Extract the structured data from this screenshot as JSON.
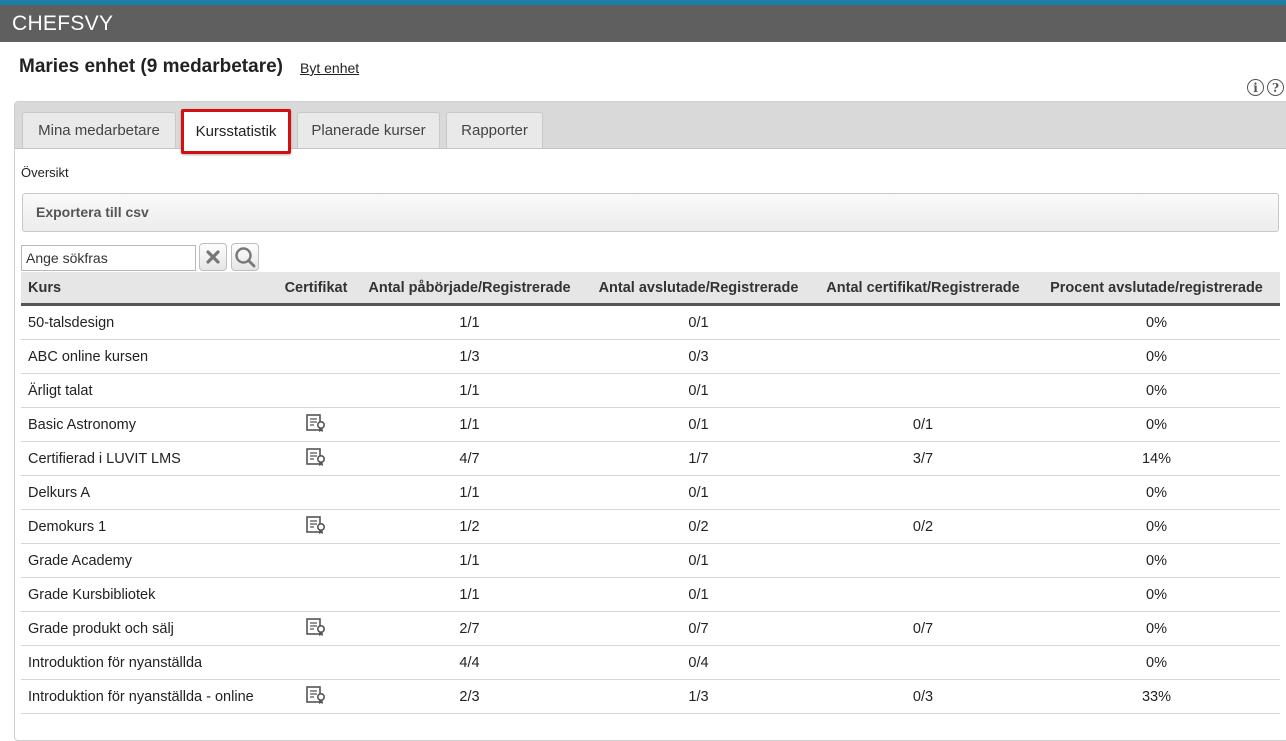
{
  "app": {
    "title": "CHEFSVY"
  },
  "unit": {
    "title": "Maries enhet (9 medarbetare)",
    "change_link": "Byt enhet"
  },
  "help": {
    "info_icon": "info-icon",
    "help_icon": "help-icon"
  },
  "tabs": [
    {
      "label": "Mina medarbetare",
      "active": false
    },
    {
      "label": "Kursstatistik",
      "active": true
    },
    {
      "label": "Planerade kurser",
      "active": false
    },
    {
      "label": "Rapporter",
      "active": false
    }
  ],
  "section": {
    "title": "Översikt",
    "export_label": "Exportera till csv"
  },
  "search": {
    "placeholder": "Ange sökfras",
    "clear_icon": "close-icon",
    "search_icon": "search-icon"
  },
  "table": {
    "columns": [
      "Kurs",
      "Certifikat",
      "Antal påbörjade/Registrerade",
      "Antal avslutade/Registrerade",
      "Antal certifikat/Registrerade",
      "Procent avslutade/registrerade"
    ],
    "rows": [
      {
        "course": "50-talsdesign",
        "certificate": false,
        "started": "1/1",
        "completed": "0/1",
        "certs": "",
        "percent": "0%"
      },
      {
        "course": "ABC online kursen",
        "certificate": false,
        "started": "1/3",
        "completed": "0/3",
        "certs": "",
        "percent": "0%"
      },
      {
        "course": "Ärligt talat",
        "certificate": false,
        "started": "1/1",
        "completed": "0/1",
        "certs": "",
        "percent": "0%"
      },
      {
        "course": "Basic Astronomy",
        "certificate": true,
        "started": "1/1",
        "completed": "0/1",
        "certs": "0/1",
        "percent": "0%"
      },
      {
        "course": "Certifierad i LUVIT LMS",
        "certificate": true,
        "started": "4/7",
        "completed": "1/7",
        "certs": "3/7",
        "percent": "14%"
      },
      {
        "course": "Delkurs A",
        "certificate": false,
        "started": "1/1",
        "completed": "0/1",
        "certs": "",
        "percent": "0%"
      },
      {
        "course": "Demokurs 1",
        "certificate": true,
        "started": "1/2",
        "completed": "0/2",
        "certs": "0/2",
        "percent": "0%"
      },
      {
        "course": "Grade Academy",
        "certificate": false,
        "started": "1/1",
        "completed": "0/1",
        "certs": "",
        "percent": "0%"
      },
      {
        "course": "Grade Kursbibliotek",
        "certificate": false,
        "started": "1/1",
        "completed": "0/1",
        "certs": "",
        "percent": "0%"
      },
      {
        "course": "Grade produkt och sälj",
        "certificate": true,
        "started": "2/7",
        "completed": "0/7",
        "certs": "0/7",
        "percent": "0%"
      },
      {
        "course": "Introduktion för nyanställda",
        "certificate": false,
        "started": "4/4",
        "completed": "0/4",
        "certs": "",
        "percent": "0%"
      },
      {
        "course": "Introduktion för nyanställda - online",
        "certificate": true,
        "started": "2/3",
        "completed": "1/3",
        "certs": "0/3",
        "percent": "33%"
      }
    ]
  },
  "colors": {
    "top_stripe": "#1d7fa3",
    "app_bar": "#5f5f5f",
    "highlight": "#d30f0f"
  }
}
